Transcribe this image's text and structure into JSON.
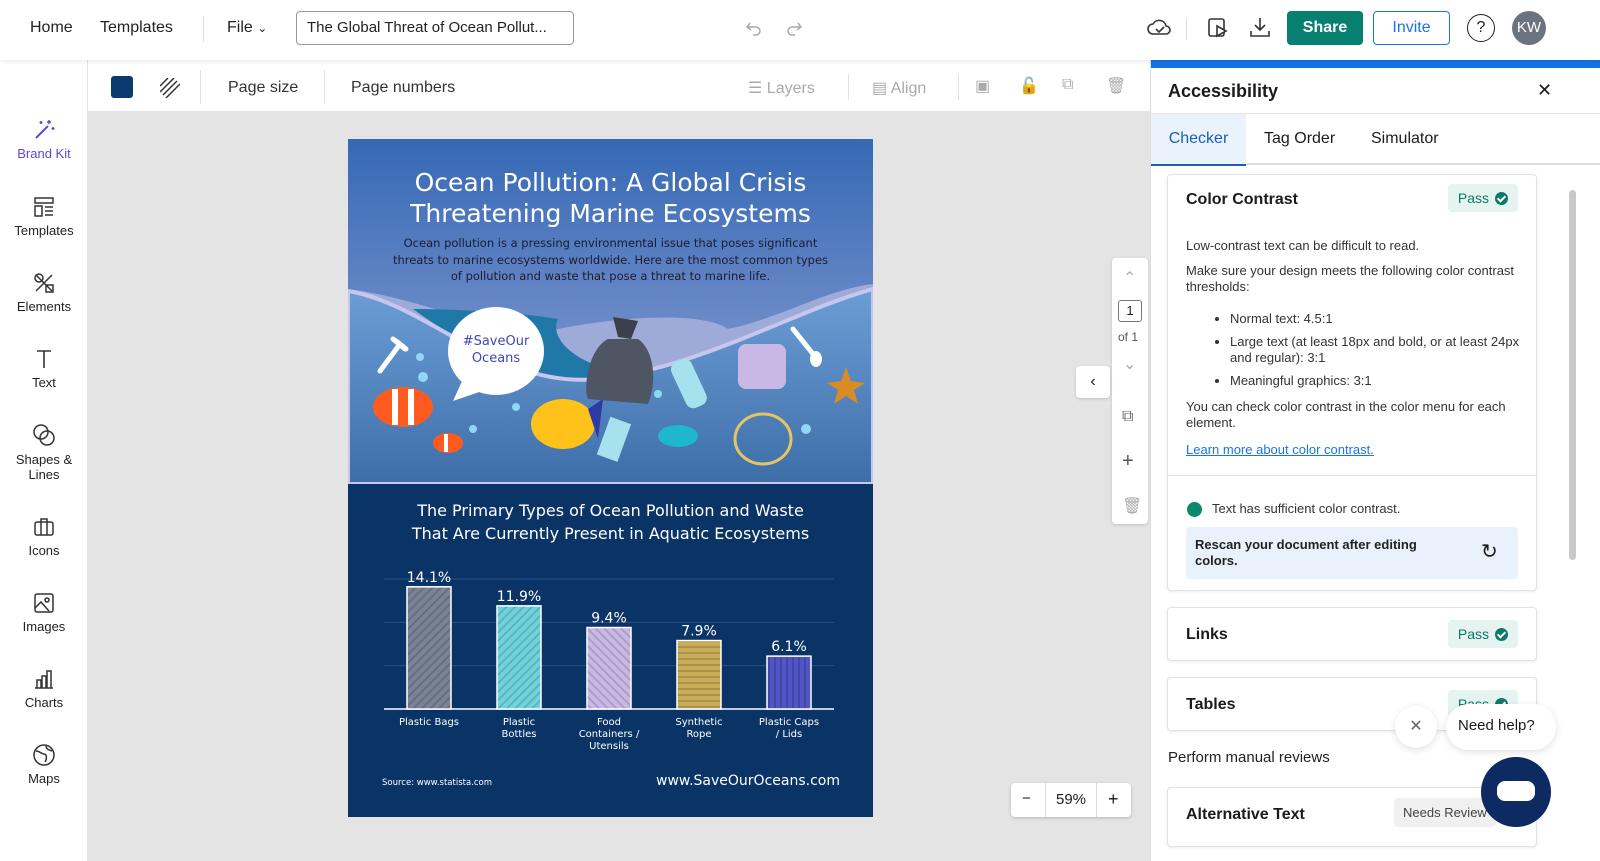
{
  "topbar": {
    "home": "Home",
    "templates": "Templates",
    "file": "File",
    "doc_title": "The Global Threat of Ocean Pollut...",
    "share": "Share",
    "invite": "Invite",
    "avatar": "KW",
    "help": "?"
  },
  "sidebar": {
    "items": [
      {
        "label": "Brand Kit",
        "icon": "magic-wand-icon"
      },
      {
        "label": "Templates",
        "icon": "templates-icon"
      },
      {
        "label": "Elements",
        "icon": "elements-icon"
      },
      {
        "label": "Text",
        "icon": "text-icon"
      },
      {
        "label": "Shapes &\nLines",
        "icon": "shapes-icon"
      },
      {
        "label": "Icons",
        "icon": "briefcase-icon"
      },
      {
        "label": "Images",
        "icon": "image-icon"
      },
      {
        "label": "Charts",
        "icon": "chart-icon"
      },
      {
        "label": "Maps",
        "icon": "globe-icon"
      }
    ]
  },
  "toolbar": {
    "page_size": "Page size",
    "page_numbers": "Page numbers",
    "layers": "Layers",
    "align": "Align",
    "bg_color": "#0b3a6e"
  },
  "pager": {
    "current": "1",
    "of": "of 1"
  },
  "zoom": {
    "minus": "−",
    "value": "59%",
    "plus": "+"
  },
  "infographic": {
    "title": "Ocean Pollution: A Global Crisis Threatening Marine Ecosystems",
    "intro": "Ocean pollution is a pressing environmental issue that poses significant threats to marine ecosystems worldwide. Here are the most common types of pollution and waste that pose a threat to marine life.",
    "bubble": "#SaveOur Oceans",
    "source": "Source: www.statista.com",
    "website": "www.SaveOurOceans.com"
  },
  "chart_data": {
    "type": "bar",
    "title": "The Primary Types of Ocean Pollution and Waste That Are Currently Present in Aquatic Ecosystems",
    "categories": [
      "Plastic Bags",
      "Plastic Bottles",
      "Food Containers / Utensils",
      "Synthetic Rope",
      "Plastic Caps / Lids"
    ],
    "values": [
      14.1,
      11.9,
      9.4,
      7.9,
      6.1
    ],
    "labels": [
      "14.1%",
      "11.9%",
      "9.4%",
      "7.9%",
      "6.1%"
    ],
    "ylim": [
      0,
      15
    ],
    "grid": true,
    "colors": [
      "#7b8396",
      "#6fd3dd",
      "#c9b8e6",
      "#c9ab58",
      "#4f55c4"
    ]
  },
  "panel": {
    "title": "Accessibility",
    "tabs": [
      "Checker",
      "Tag Order",
      "Simulator"
    ],
    "color_contrast": {
      "title": "Color Contrast",
      "status": "Pass",
      "p1": "Low-contrast text can be difficult to read.",
      "p2": "Make sure your design meets the following color contrast thresholds:",
      "bullets": [
        "Normal text: 4.5:1",
        "Large text (at least 18px and bold, or at least 24px and regular): 3:1",
        "Meaningful graphics: 3:1"
      ],
      "p3": "You can check color contrast in the color menu for each element.",
      "link": "Learn more about color contrast.",
      "result": "Text has sufficient color contrast.",
      "rescan": "Rescan your document after editing colors."
    },
    "links": {
      "title": "Links",
      "status": "Pass"
    },
    "tables": {
      "title": "Tables",
      "status": "Pass"
    },
    "manual": "Perform manual reviews",
    "alt_text": {
      "title": "Alternative Text",
      "status": "Needs Review"
    },
    "help": "Need help?"
  }
}
